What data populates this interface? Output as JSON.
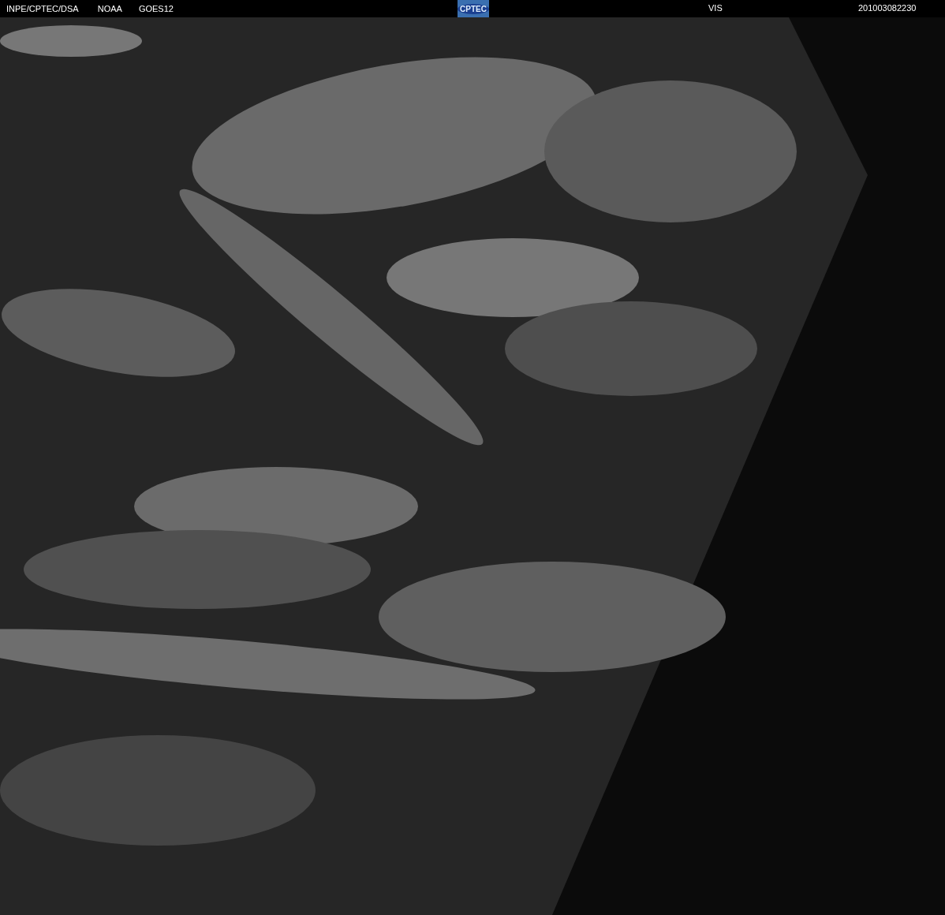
{
  "header": {
    "source": "INPE/CPTEC/DSA",
    "agency": "NOAA",
    "satellite": "GOES12",
    "logo": "CPTEC",
    "channel": "VIS",
    "timestamp": "201003082230"
  }
}
